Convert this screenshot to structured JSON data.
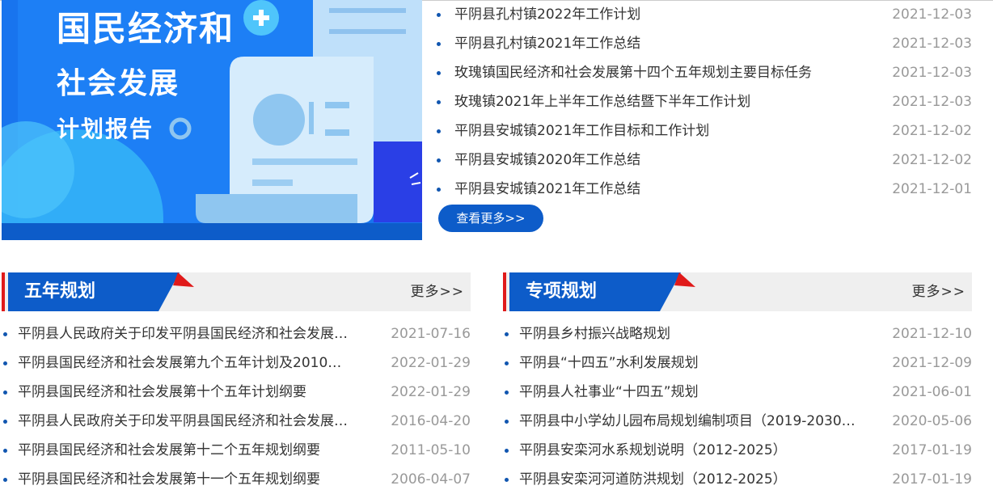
{
  "banner": {
    "line1": "国民经济和",
    "line2": "社会发展",
    "line3": "计划报告",
    "plus_icon": "plus-circle-icon",
    "colors": {
      "bg": "#1874ee",
      "dark": "#0d5cc9",
      "paper": "#bfe0fa"
    }
  },
  "top_news": {
    "items": [
      {
        "title": "平阴县孔村镇2022年工作计划",
        "date": "2021-12-03"
      },
      {
        "title": "平阴县孔村镇2021年工作总结",
        "date": "2021-12-03"
      },
      {
        "title": "玫瑰镇国民经济和社会发展第十四个五年规划主要目标任务",
        "date": "2021-12-03"
      },
      {
        "title": "玫瑰镇2021年上半年工作总结暨下半年工作计划",
        "date": "2021-12-03"
      },
      {
        "title": "平阴县安城镇2021年工作目标和工作计划",
        "date": "2021-12-02"
      },
      {
        "title": "平阴县安城镇2020年工作总结",
        "date": "2021-12-02"
      },
      {
        "title": "平阴县安城镇2021年工作总结",
        "date": "2021-12-01"
      }
    ],
    "more_label": "查看更多>>"
  },
  "panels": {
    "five_year": {
      "title": "五年规划",
      "more_label": "更多>>",
      "items": [
        {
          "title": "平阴县人民政府关于印发平阴县国民经济和社会发展…",
          "date": "2021-07-16"
        },
        {
          "title": "平阴县国民经济和社会发展第九个五年计划及2010…",
          "date": "2022-01-29"
        },
        {
          "title": "平阴县国民经济和社会发展第十个五年计划纲要",
          "date": "2022-01-29"
        },
        {
          "title": "平阴县人民政府关于印发平阴县国民经济和社会发展…",
          "date": "2016-04-20"
        },
        {
          "title": "平阴县国民经济和社会发展第十二个五年规划纲要",
          "date": "2011-05-10"
        },
        {
          "title": "平阴县国民经济和社会发展第十一个五年规划纲要",
          "date": "2006-04-07"
        }
      ]
    },
    "special": {
      "title": "专项规划",
      "more_label": "更多>>",
      "items": [
        {
          "title": "平阴县乡村振兴战略规划",
          "date": "2021-12-10"
        },
        {
          "title": "平阴县“十四五”水利发展规划",
          "date": "2021-12-09"
        },
        {
          "title": "平阴县人社事业“十四五”规划",
          "date": "2021-06-01"
        },
        {
          "title": "平阴县中小学幼儿园布局规划编制项目（2019-2030…",
          "date": "2020-05-06"
        },
        {
          "title": "平阴县安栾河水系规划说明（2012-2025）",
          "date": "2017-01-19"
        },
        {
          "title": "平阴县安栾河河道防洪规划（2012-2025）",
          "date": "2017-01-19"
        }
      ]
    },
    "colors": {
      "head_blue": "#0d5cc9",
      "accent_red": "#e01a1a",
      "head_bg": "#efefef"
    }
  }
}
